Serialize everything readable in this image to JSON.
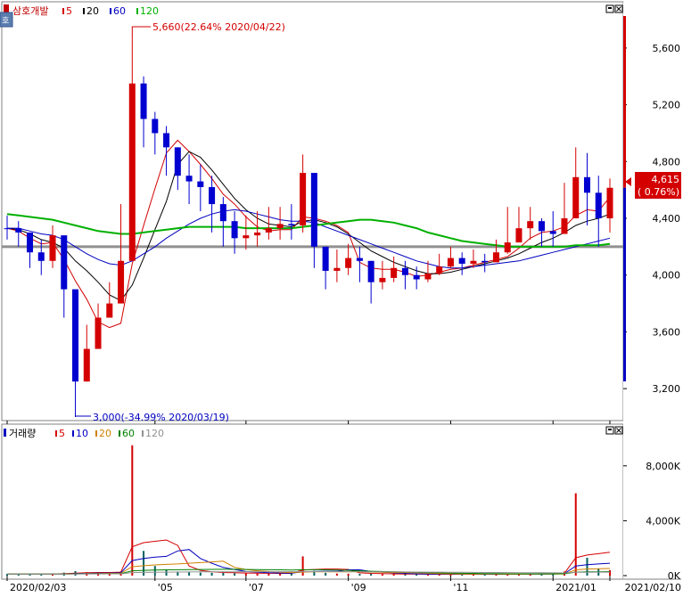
{
  "price_panel": {
    "title": "삼호개발",
    "legend": [
      {
        "label": "5",
        "color": "#d40000"
      },
      {
        "label": "20",
        "color": "#000000"
      },
      {
        "label": "60",
        "color": "#0000c0"
      },
      {
        "label": "120",
        "color": "#00b000"
      }
    ],
    "current_price": "4,615",
    "current_change": "( 0.76%)",
    "high_annotation": "5,660(22.64% 2020/04/22)",
    "low_annotation": "3,000(-34.99% 2020/03/19)"
  },
  "volume_panel": {
    "title": "거래량",
    "legend": [
      {
        "label": "5",
        "color": "#d40000"
      },
      {
        "label": "10",
        "color": "#0000c0"
      },
      {
        "label": "20",
        "color": "#d08000"
      },
      {
        "label": "60",
        "color": "#008000"
      },
      {
        "label": "120",
        "color": "#909090"
      }
    ]
  },
  "chart_data": [
    {
      "type": "candlestick",
      "title": "삼호개발",
      "x_tick_labels": [
        "2020/02/03",
        "'05",
        "'07",
        "'09",
        "'11",
        "2021/01",
        "2021/02/10"
      ],
      "y_tick_labels": [
        "3,200",
        "3,600",
        "4,000",
        "4,400",
        "4,800",
        "5,200",
        "5,600"
      ],
      "ylim": [
        3000,
        5800
      ],
      "x_dates": [
        "2020-02-03",
        "2020-02-10",
        "2020-02-17",
        "2020-02-24",
        "2020-03-02",
        "2020-03-09",
        "2020-03-16",
        "2020-03-23",
        "2020-03-30",
        "2020-04-06",
        "2020-04-13",
        "2020-04-20",
        "2020-04-27",
        "2020-05-04",
        "2020-05-11",
        "2020-05-18",
        "2020-05-25",
        "2020-06-01",
        "2020-06-08",
        "2020-06-15",
        "2020-06-22",
        "2020-06-29",
        "2020-07-06",
        "2020-07-13",
        "2020-07-20",
        "2020-07-27",
        "2020-08-03",
        "2020-08-10",
        "2020-08-17",
        "2020-08-24",
        "2020-08-31",
        "2020-09-07",
        "2020-09-14",
        "2020-09-21",
        "2020-09-28",
        "2020-10-05",
        "2020-10-12",
        "2020-10-19",
        "2020-10-26",
        "2020-11-02",
        "2020-11-09",
        "2020-11-16",
        "2020-11-23",
        "2020-11-30",
        "2020-12-07",
        "2020-12-14",
        "2020-12-21",
        "2020-12-28",
        "2021-01-04",
        "2021-01-11",
        "2021-01-18",
        "2021-01-25",
        "2021-02-01",
        "2021-02-08"
      ],
      "close": [
        4330,
        4300,
        4160,
        4100,
        4280,
        3900,
        3250,
        3480,
        3700,
        3800,
        4100,
        5350,
        5100,
        5000,
        4900,
        4700,
        4660,
        4620,
        4500,
        4380,
        4260,
        4280,
        4300,
        4330,
        4360,
        4350,
        4720,
        4200,
        4030,
        4050,
        4120,
        4100,
        3950,
        3980,
        4050,
        4000,
        3970,
        4010,
        4060,
        4120,
        4080,
        4100,
        4090,
        4160,
        4230,
        4330,
        4380,
        4310,
        4290,
        4400,
        4690,
        4580,
        4400,
        4615
      ],
      "high": [
        4420,
        4380,
        4300,
        4250,
        4350,
        4200,
        3300,
        3650,
        3800,
        3950,
        4500,
        5660,
        5400,
        5150,
        5050,
        4900,
        4850,
        4780,
        4700,
        4550,
        4450,
        4420,
        4450,
        4480,
        4480,
        4500,
        4850,
        4450,
        4200,
        4180,
        4220,
        4200,
        4100,
        4100,
        4130,
        4100,
        4060,
        4100,
        4150,
        4200,
        4160,
        4180,
        4150,
        4250,
        4480,
        4480,
        4480,
        4400,
        4450,
        4650,
        4900,
        4860,
        4700,
        4680
      ],
      "low": [
        4250,
        4200,
        4050,
        4000,
        4050,
        3700,
        3000,
        3250,
        3550,
        3700,
        4000,
        4600,
        4900,
        4850,
        4700,
        4600,
        4500,
        4450,
        4300,
        4200,
        4150,
        4180,
        4200,
        4250,
        4250,
        4250,
        4300,
        4050,
        3900,
        3950,
        4000,
        3950,
        3800,
        3900,
        3950,
        3900,
        3900,
        3950,
        4000,
        4050,
        4000,
        4050,
        4020,
        4100,
        4150,
        4250,
        4250,
        4200,
        4200,
        4300,
        4400,
        4350,
        4200,
        4300
      ],
      "up": [
        false,
        false,
        false,
        false,
        true,
        false,
        false,
        true,
        true,
        true,
        true,
        true,
        false,
        false,
        false,
        false,
        false,
        false,
        false,
        false,
        false,
        true,
        true,
        true,
        true,
        false,
        true,
        false,
        false,
        true,
        true,
        false,
        false,
        true,
        true,
        false,
        false,
        true,
        true,
        true,
        false,
        true,
        false,
        true,
        true,
        true,
        true,
        false,
        false,
        true,
        true,
        false,
        false,
        true
      ],
      "moving_averages": [
        {
          "name": "5",
          "color": "#d40000",
          "values": [
            4330,
            4310,
            4260,
            4220,
            4230,
            4110,
            3960,
            3830,
            3670,
            3630,
            3660,
            4080,
            4350,
            4610,
            4860,
            4950,
            4870,
            4780,
            4680,
            4570,
            4500,
            4410,
            4340,
            4310,
            4320,
            4320,
            4410,
            4400,
            4380,
            4350,
            4300,
            4090,
            4050,
            4040,
            4040,
            4020,
            3990,
            4000,
            4020,
            4040,
            4050,
            4070,
            4090,
            4110,
            4130,
            4190,
            4260,
            4300,
            4310,
            4340,
            4420,
            4460,
            4450,
            4550
          ]
        },
        {
          "name": "20",
          "color": "#000000",
          "values": [
            4330,
            4320,
            4290,
            4250,
            4230,
            4190,
            4100,
            4030,
            3950,
            3860,
            3820,
            3930,
            4120,
            4320,
            4520,
            4780,
            4870,
            4830,
            4740,
            4640,
            4540,
            4460,
            4400,
            4360,
            4350,
            4340,
            4380,
            4390,
            4370,
            4340,
            4290,
            4230,
            4170,
            4130,
            4090,
            4060,
            4030,
            4010,
            4010,
            4020,
            4040,
            4060,
            4080,
            4100,
            4120,
            4150,
            4190,
            4230,
            4260,
            4300,
            4350,
            4380,
            4400,
            4430
          ]
        },
        {
          "name": "60",
          "color": "#0000c0",
          "values": [
            4330,
            4330,
            4310,
            4290,
            4280,
            4250,
            4200,
            4150,
            4110,
            4080,
            4070,
            4100,
            4150,
            4200,
            4260,
            4310,
            4360,
            4400,
            4430,
            4450,
            4460,
            4450,
            4430,
            4410,
            4390,
            4380,
            4380,
            4370,
            4340,
            4310,
            4280,
            4250,
            4220,
            4190,
            4160,
            4130,
            4100,
            4080,
            4060,
            4050,
            4050,
            4060,
            4070,
            4080,
            4090,
            4100,
            4120,
            4140,
            4160,
            4180,
            4200,
            4220,
            4240,
            4260
          ]
        },
        {
          "name": "120",
          "color": "#00b000",
          "values": [
            4430,
            4420,
            4410,
            4400,
            4390,
            4370,
            4350,
            4330,
            4310,
            4300,
            4290,
            4290,
            4300,
            4310,
            4320,
            4330,
            4340,
            4340,
            4340,
            4340,
            4340,
            4330,
            4330,
            4330,
            4330,
            4330,
            4340,
            4350,
            4360,
            4370,
            4380,
            4390,
            4390,
            4380,
            4370,
            4350,
            4330,
            4300,
            4280,
            4260,
            4240,
            4230,
            4220,
            4210,
            4200,
            4200,
            4200,
            4200,
            4200,
            4200,
            4210,
            4210,
            4210,
            4220
          ]
        }
      ],
      "reference_line": 4200
    },
    {
      "type": "bar",
      "title": "거래량",
      "y_tick_labels": [
        "0K",
        "4,000K",
        "8,000K"
      ],
      "ylim": [
        0,
        10000000
      ],
      "x_dates_ref": "same as price panel",
      "values": [
        120000,
        110000,
        100000,
        120000,
        150000,
        220000,
        330000,
        250000,
        180000,
        160000,
        300000,
        9500000,
        1800000,
        700000,
        450000,
        300000,
        250000,
        220000,
        200000,
        200000,
        180000,
        160000,
        150000,
        150000,
        170000,
        160000,
        1400000,
        350000,
        200000,
        150000,
        140000,
        130000,
        140000,
        120000,
        110000,
        100000,
        100000,
        90000,
        90000,
        110000,
        100000,
        100000,
        90000,
        110000,
        120000,
        150000,
        160000,
        130000,
        150000,
        300000,
        6000000,
        1300000,
        500000,
        400000
      ],
      "moving_averages": [
        {
          "name": "5",
          "color": "#d40000",
          "values": [
            120000,
            115000,
            110000,
            112000,
            120000,
            140000,
            180000,
            210000,
            230000,
            230000,
            250000,
            2100000,
            2400000,
            2500000,
            2600000,
            2200000,
            700000,
            380000,
            280000,
            230000,
            210000,
            190000,
            180000,
            170000,
            165000,
            160000,
            400000,
            450000,
            480000,
            480000,
            450000,
            200000,
            160000,
            140000,
            130000,
            120000,
            115000,
            105000,
            100000,
            100000,
            100000,
            100000,
            98000,
            100000,
            105000,
            115000,
            125000,
            135000,
            140000,
            170000,
            1300000,
            1500000,
            1600000,
            1700000
          ]
        },
        {
          "name": "10",
          "color": "#0000c0",
          "values": [
            120000,
            118000,
            115000,
            114000,
            116000,
            125000,
            145000,
            160000,
            175000,
            185000,
            200000,
            1100000,
            1250000,
            1350000,
            1400000,
            1800000,
            1900000,
            1250000,
            900000,
            600000,
            450000,
            300000,
            250000,
            210000,
            190000,
            180000,
            280000,
            300000,
            320000,
            320000,
            420000,
            420000,
            300000,
            250000,
            200000,
            160000,
            130000,
            120000,
            115000,
            110000,
            105000,
            102000,
            100000,
            100000,
            102000,
            108000,
            115000,
            120000,
            125000,
            140000,
            700000,
            800000,
            850000,
            900000
          ]
        },
        {
          "name": "20",
          "color": "#d08000",
          "values": [
            120000,
            118000,
            116000,
            115000,
            115000,
            118000,
            130000,
            140000,
            150000,
            160000,
            170000,
            650000,
            720000,
            780000,
            820000,
            850000,
            900000,
            950000,
            1000000,
            1050000,
            600000,
            450000,
            350000,
            300000,
            250000,
            220000,
            260000,
            280000,
            280000,
            270000,
            280000,
            290000,
            260000,
            240000,
            230000,
            220000,
            200000,
            180000,
            150000,
            130000,
            120000,
            115000,
            110000,
            108000,
            105000,
            105000,
            108000,
            110000,
            115000,
            125000,
            420000,
            480000,
            500000,
            520000
          ]
        },
        {
          "name": "60",
          "color": "#008000",
          "values": [
            120000,
            118000,
            117000,
            116000,
            116000,
            118000,
            125000,
            130000,
            135000,
            140000,
            145000,
            350000,
            380000,
            400000,
            420000,
            430000,
            440000,
            450000,
            455000,
            460000,
            460000,
            450000,
            440000,
            430000,
            420000,
            410000,
            430000,
            430000,
            420000,
            400000,
            380000,
            350000,
            320000,
            300000,
            280000,
            260000,
            240000,
            220000,
            200000,
            185000,
            170000,
            160000,
            150000,
            140000,
            135000,
            130000,
            130000,
            130000,
            130000,
            135000,
            250000,
            270000,
            280000,
            290000
          ]
        },
        {
          "name": "120",
          "color": "#909090",
          "values": [
            120000,
            119000,
            118000,
            117000,
            117000,
            118000,
            120000,
            122000,
            125000,
            128000,
            130000,
            220000,
            235000,
            245000,
            255000,
            262000,
            268000,
            272000,
            276000,
            280000,
            282000,
            283000,
            284000,
            285000,
            285000,
            285000,
            290000,
            292000,
            292000,
            290000,
            288000,
            285000,
            280000,
            275000,
            270000,
            265000,
            260000,
            255000,
            250000,
            245000,
            240000,
            235000,
            230000,
            225000,
            220000,
            215000,
            210000,
            205000,
            200000,
            198000,
            240000,
            245000,
            250000,
            255000
          ]
        }
      ]
    }
  ]
}
